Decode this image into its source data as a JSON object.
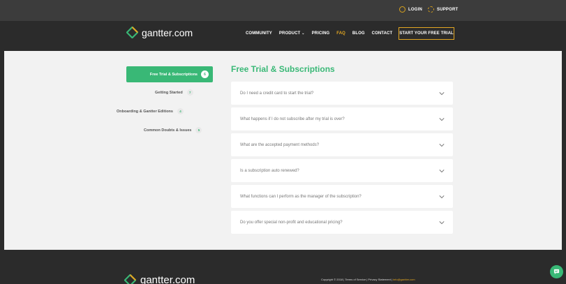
{
  "topbar": {
    "login_label": "LOGIN",
    "support_label": "SUPPORT"
  },
  "nav": {
    "logo_text": "gantter.com",
    "items": [
      {
        "label": "COMMUNITY"
      },
      {
        "label": "PRODUCT"
      },
      {
        "label": "PRICING"
      },
      {
        "label": "FAQ"
      },
      {
        "label": "BLOG"
      },
      {
        "label": "CONTACT"
      }
    ],
    "cta_label": "START YOUR FREE TRIAL"
  },
  "sidebar": {
    "items": [
      {
        "label": "Free Trial & Subscriptions",
        "count": "6"
      },
      {
        "label": "Getting Started",
        "count": "7"
      },
      {
        "label": "Onboarding & Gantter Editions",
        "count": "4"
      },
      {
        "label": "Common Doubts & Issues",
        "count": "5"
      }
    ]
  },
  "faq": {
    "title": "Free Trial & Subscriptions",
    "questions": [
      {
        "q": "Do I need a credit card to start the trial?"
      },
      {
        "q": "What happens if I do not subscribe after my trial is over?"
      },
      {
        "q": "What are the accepted payment methods?"
      },
      {
        "q": "Is a subscription auto renewed?"
      },
      {
        "q": "What functions can I perform as the manager of the subscription?"
      },
      {
        "q": "Do you offer special non-profit and educational pricing?"
      }
    ]
  },
  "footer": {
    "logo_text": "gantter.com",
    "copyright": "Copyright © 2018 | Terms of Service | Privacy Statement | ",
    "email": "info@gantter.com"
  },
  "colors": {
    "accent_green": "#39b876",
    "accent_gold": "#e3a722",
    "dark_bg": "#2b2b2b"
  },
  "icons": {
    "login": "user-circle-icon",
    "support": "lifebuoy-icon",
    "logo": "diamond-logo-icon",
    "chevron": "chevron-down-icon",
    "chat": "chat-bubble-icon"
  }
}
